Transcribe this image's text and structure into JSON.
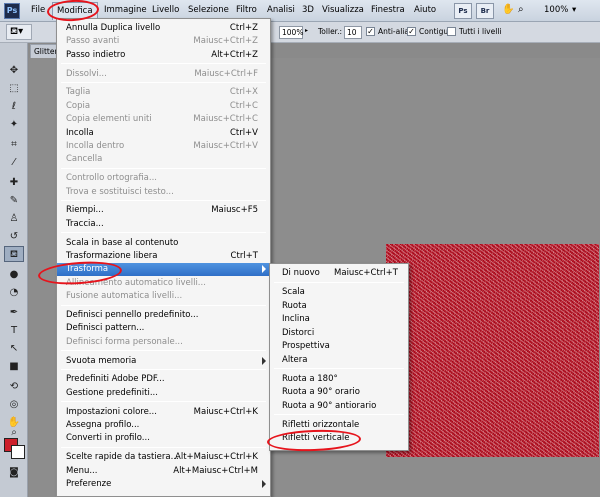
{
  "app": {
    "logo": "Ps"
  },
  "menubar": {
    "items": [
      "File",
      "Modifica",
      "Immagine",
      "Livello",
      "Selezione",
      "Filtro",
      "Analisi",
      "3D",
      "Visualizza",
      "Finestra",
      "Aiuto"
    ],
    "zoom": "100%",
    "right_icons": [
      "Ps",
      "Br"
    ]
  },
  "options": {
    "opacity_value": "100%",
    "tolerance_label": "Toller.:",
    "tolerance_value": "10",
    "antialias_label": "Anti-alias",
    "contiguous_label": "Contigui",
    "all_layers_label": "Tutti i livelli"
  },
  "document": {
    "tab_title": "Glitter"
  },
  "edit_menu": [
    {
      "label": "Annulla Duplica livello",
      "shortcut": "Ctrl+Z",
      "disabled": false
    },
    {
      "label": "Passo avanti",
      "shortcut": "Maiusc+Ctrl+Z",
      "disabled": true
    },
    {
      "label": "Passo indietro",
      "shortcut": "Alt+Ctrl+Z",
      "disabled": false
    },
    {
      "sep": true
    },
    {
      "label": "Dissolvi...",
      "shortcut": "Maiusc+Ctrl+F",
      "disabled": true
    },
    {
      "sep": true
    },
    {
      "label": "Taglia",
      "shortcut": "Ctrl+X",
      "disabled": true
    },
    {
      "label": "Copia",
      "shortcut": "Ctrl+C",
      "disabled": true
    },
    {
      "label": "Copia elementi uniti",
      "shortcut": "Maiusc+Ctrl+C",
      "disabled": true
    },
    {
      "label": "Incolla",
      "shortcut": "Ctrl+V",
      "disabled": false
    },
    {
      "label": "Incolla dentro",
      "shortcut": "Maiusc+Ctrl+V",
      "disabled": true
    },
    {
      "label": "Cancella",
      "shortcut": "",
      "disabled": true
    },
    {
      "sep": true
    },
    {
      "label": "Controllo ortografia...",
      "shortcut": "",
      "disabled": true
    },
    {
      "label": "Trova e sostituisci testo...",
      "shortcut": "",
      "disabled": true
    },
    {
      "sep": true
    },
    {
      "label": "Riempi...",
      "shortcut": "Maiusc+F5",
      "disabled": false
    },
    {
      "label": "Traccia...",
      "shortcut": "",
      "disabled": false
    },
    {
      "sep": true
    },
    {
      "label": "Scala in base al contenuto",
      "shortcut": "",
      "disabled": false
    },
    {
      "label": "Trasformazione libera",
      "shortcut": "Ctrl+T",
      "disabled": false
    },
    {
      "label": "Trasforma",
      "shortcut": "",
      "disabled": false,
      "highlight": true,
      "submenu": true
    },
    {
      "label": "Allineamento automatico livelli...",
      "shortcut": "",
      "disabled": true
    },
    {
      "label": "Fusione automatica livelli...",
      "shortcut": "",
      "disabled": true
    },
    {
      "sep": true
    },
    {
      "label": "Definisci pennello predefinito...",
      "shortcut": "",
      "disabled": false
    },
    {
      "label": "Definisci pattern...",
      "shortcut": "",
      "disabled": false
    },
    {
      "label": "Definisci forma personale...",
      "shortcut": "",
      "disabled": true
    },
    {
      "sep": true
    },
    {
      "label": "Svuota memoria",
      "shortcut": "",
      "disabled": false,
      "submenu": true
    },
    {
      "sep": true
    },
    {
      "label": "Predefiniti Adobe PDF...",
      "shortcut": "",
      "disabled": false
    },
    {
      "label": "Gestione predefiniti...",
      "shortcut": "",
      "disabled": false
    },
    {
      "sep": true
    },
    {
      "label": "Impostazioni colore...",
      "shortcut": "Maiusc+Ctrl+K",
      "disabled": false
    },
    {
      "label": "Assegna profilo...",
      "shortcut": "",
      "disabled": false
    },
    {
      "label": "Converti in profilo...",
      "shortcut": "",
      "disabled": false
    },
    {
      "sep": true
    },
    {
      "label": "Scelte rapide da tastiera...",
      "shortcut": "Alt+Maiusc+Ctrl+K",
      "disabled": false
    },
    {
      "label": "Menu...",
      "shortcut": "Alt+Maiusc+Ctrl+M",
      "disabled": false
    },
    {
      "label": "Preferenze",
      "shortcut": "",
      "disabled": false,
      "submenu": true
    }
  ],
  "transform_submenu": [
    {
      "label": "Di nuovo",
      "shortcut": "Maiusc+Ctrl+T"
    },
    {
      "sep": true
    },
    {
      "label": "Scala",
      "shortcut": ""
    },
    {
      "label": "Ruota",
      "shortcut": ""
    },
    {
      "label": "Inclina",
      "shortcut": ""
    },
    {
      "label": "Distorci",
      "shortcut": ""
    },
    {
      "label": "Prospettiva",
      "shortcut": ""
    },
    {
      "label": "Altera",
      "shortcut": ""
    },
    {
      "sep": true
    },
    {
      "label": "Ruota a 180°",
      "shortcut": ""
    },
    {
      "label": "Ruota a 90° orario",
      "shortcut": ""
    },
    {
      "label": "Ruota a 90° antiorario",
      "shortcut": ""
    },
    {
      "sep": true
    },
    {
      "label": "Rifletti orizzontale",
      "shortcut": ""
    },
    {
      "label": "Rifletti verticale",
      "shortcut": ""
    }
  ],
  "colors": {
    "foreground": "#cc1f2b",
    "background": "#ffffff",
    "annotation": "#e6141c",
    "highlight": "#3a7fd5"
  }
}
